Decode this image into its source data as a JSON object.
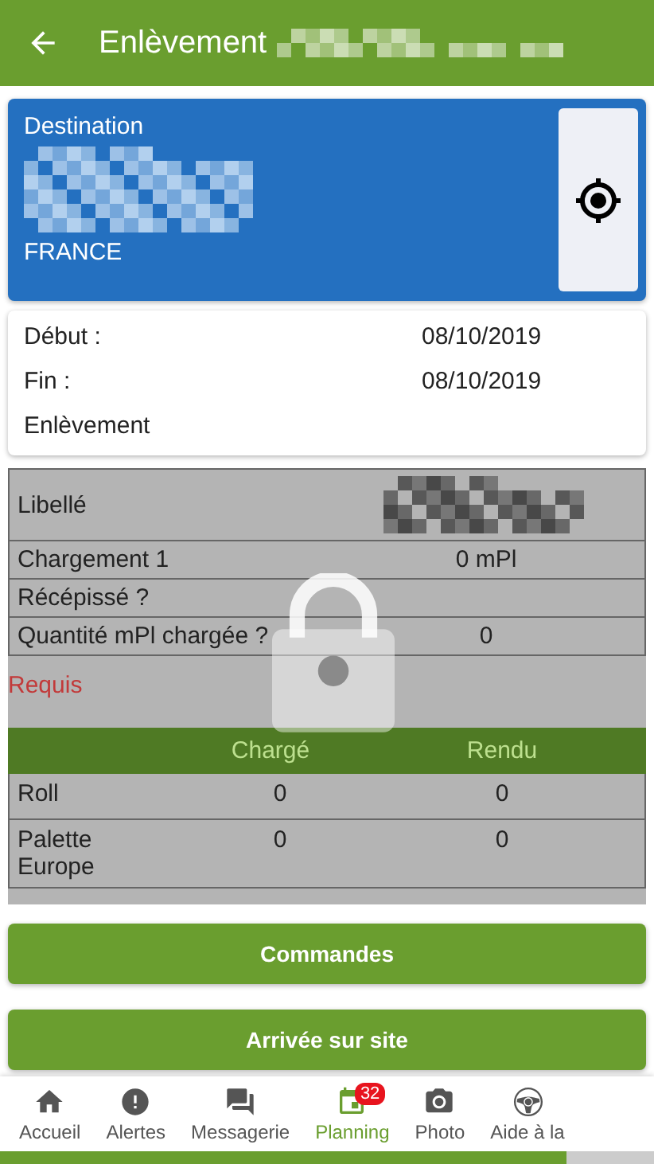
{
  "header": {
    "title": "Enlèvement"
  },
  "destination": {
    "label": "Destination",
    "country": "FRANCE"
  },
  "schedule": {
    "rows": [
      {
        "label": "Début :",
        "value": "08/10/2019"
      },
      {
        "label": "Fin :",
        "value": "08/10/2019"
      }
    ],
    "type": "Enlèvement"
  },
  "details": [
    {
      "label": "Libellé"
    },
    {
      "label": "Chargement 1",
      "value": "0 mPl"
    },
    {
      "label": "Récépissé ?"
    },
    {
      "label": "Quantité mPl chargée ?",
      "value": "0"
    }
  ],
  "required": "Requis",
  "quantities": {
    "columns": [
      "Chargé",
      "Rendu"
    ],
    "rows": [
      {
        "label": "Roll",
        "values": [
          "0",
          "0"
        ]
      },
      {
        "label": "Palette Europe",
        "values": [
          "0",
          "0"
        ]
      }
    ]
  },
  "buttons": [
    "Commandes",
    "Arrivée sur site"
  ],
  "nav": [
    {
      "label": "Accueil",
      "selected": false
    },
    {
      "label": "Alertes",
      "selected": false
    },
    {
      "label": "Messagerie",
      "selected": false
    },
    {
      "label": "Planning",
      "selected": true,
      "badge": "32"
    },
    {
      "label": "Photo",
      "selected": false
    },
    {
      "label": "Aide à la",
      "selected": false
    }
  ]
}
